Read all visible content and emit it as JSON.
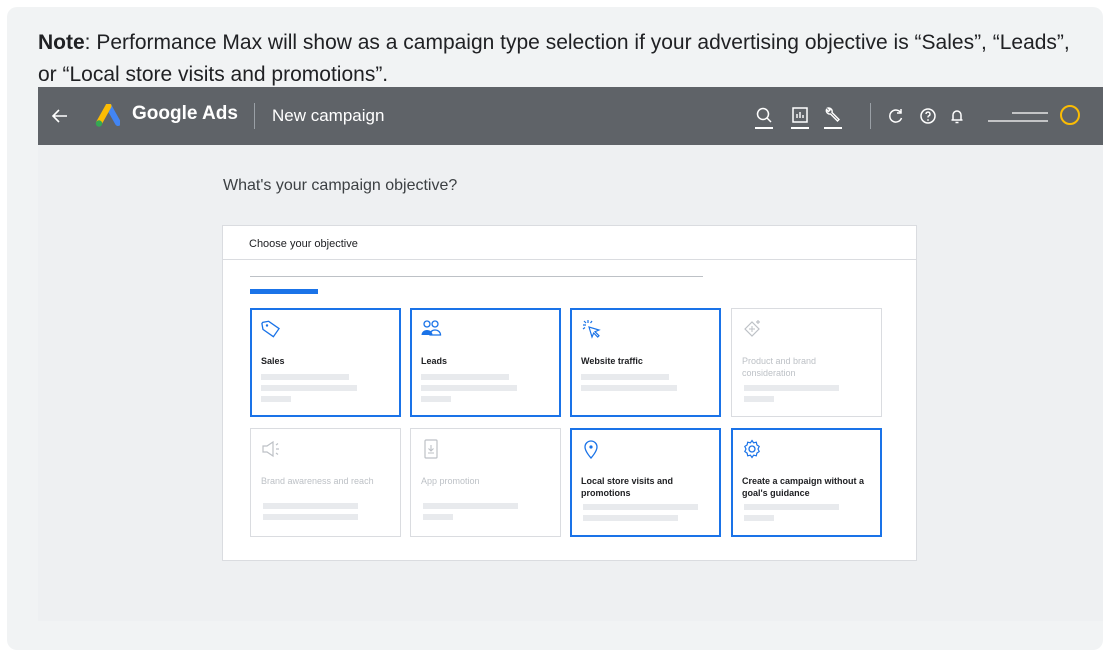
{
  "note": {
    "bold": "Note",
    "text": ": Performance Max will show as a campaign type selection if your advertising objective is “Sales”, “Leads”, or “Local store visits and promotions”."
  },
  "topbar": {
    "brand": "Google Ads",
    "page_title": "New campaign",
    "icons": [
      "back-arrow-icon",
      "google-ads-logo-icon",
      "search-icon",
      "reports-icon",
      "tools-icon",
      "refresh-icon",
      "help-icon",
      "notifications-icon",
      "avatar"
    ]
  },
  "main": {
    "question": "What's your campaign objective?",
    "panel_title": "Choose your objective",
    "progress": 0.15,
    "objectives": [
      {
        "label": "Sales",
        "icon": "tag-icon",
        "selected": true
      },
      {
        "label": "Leads",
        "icon": "people-icon",
        "selected": true
      },
      {
        "label": "Website traffic",
        "icon": "cursor-click-icon",
        "selected": true
      },
      {
        "label": "Product and brand consideration",
        "icon": "sparkle-icon",
        "selected": false
      },
      {
        "label": "Brand awareness and reach",
        "icon": "speaker-icon",
        "selected": false
      },
      {
        "label": "App promotion",
        "icon": "phone-download-icon",
        "selected": false
      },
      {
        "label": "Local store visits and promotions",
        "icon": "location-pin-icon",
        "selected": true
      },
      {
        "label": "Create a campaign without a goal's guidance",
        "icon": "gear-icon",
        "selected": true
      }
    ]
  },
  "colors": {
    "accent": "#1a73e8",
    "topbar": "#5f6368",
    "avatar_ring": "#fbbc04",
    "disabled": "#bdc1c6"
  }
}
